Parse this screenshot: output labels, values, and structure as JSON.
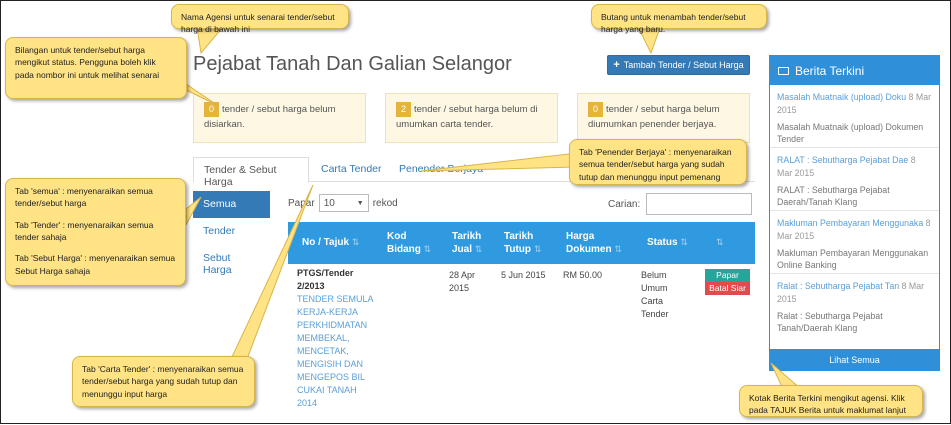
{
  "page": {
    "title": "Pejabat Tanah Dan Galian Selangor",
    "add_button": "Tambah Tender / Sebut Harga"
  },
  "stats": [
    {
      "count": "0",
      "text_a": "tender / sebut harga belum",
      "text_b": "disiarkan."
    },
    {
      "count": "2",
      "text_a": "tender / sebut harga belum di",
      "text_b": "umumkan carta tender."
    },
    {
      "count": "0",
      "text_a": "tender / sebut harga belum",
      "text_b": "diumumkan penender berjaya."
    }
  ],
  "tabs": [
    "Tender & Sebut Harga",
    "Carta Tender",
    "Penender Berjaya"
  ],
  "sidebar": [
    "Semua",
    "Tender",
    "Sebut Harga"
  ],
  "table_controls": {
    "page_label": "Papar",
    "page_value": "10",
    "rekod_label": "rekod",
    "search_label": "Carian:"
  },
  "table": {
    "headers": [
      {
        "a": "No / Tajuk",
        "b": ""
      },
      {
        "a": "Kod",
        "b": "Bidang"
      },
      {
        "a": "Tarikh",
        "b": "Jual"
      },
      {
        "a": "Tarikh",
        "b": "Tutup"
      },
      {
        "a": "Harga",
        "b": "Dokumen"
      },
      {
        "a": "Status",
        "b": ""
      }
    ],
    "sort_icon": "⇅",
    "row": {
      "no_a": "PTGS/Tender",
      "no_b": "2/2013",
      "tajuk": [
        "TENDER SEMULA",
        "KERJA-KERJA",
        "PERKHIDMATAN",
        "MEMBEKAL,",
        "MENCETAK,",
        "MENGISIH DAN",
        "MENGEPOS BIL",
        "CUKAI TANAH",
        "2014"
      ],
      "jual_a": "28 Apr",
      "jual_b": "2015",
      "tutup": "5 Jun 2015",
      "harga": "RM 50.00",
      "status": [
        "Belum",
        "Umum",
        "Carta",
        "Tender"
      ],
      "btn_papar": "Papar",
      "btn_batal": "Batal Siar"
    }
  },
  "news": {
    "header": "Berita Terkini",
    "footer": "Lihat Semua",
    "items": [
      {
        "title": "Masalah Muatnaik (upload) Doku",
        "date": "8 Mar 2015",
        "summary": "Masalah Muatnaik (upload) Dokumen Tender"
      },
      {
        "title": "RALAT : Sebutharga Pejabat Dae",
        "date": "8 Mar 2015",
        "summary": "RALAT : Sebutharga Pejabat Daerah/Tanah Klang"
      },
      {
        "title": "Makluman Pembayaran Menggunaka",
        "date": "8 Mar 2015",
        "summary": "Makluman Pembayaran Menggunakan Online Banking"
      },
      {
        "title": "Ralat : Sebutharga Pejabat Tan",
        "date": "8 Mar 2015",
        "summary": "Ralat : Sebutharga Pejabat Tanah/Daerah Klang"
      }
    ]
  },
  "callouts": {
    "agency": "Nama Agensi untuk senarai tender/sebut harga di bawah ini",
    "add": "Butang untuk menambah tender/sebut harga yang baru.",
    "count": "Bilangan untuk tender/sebut harga mengikut status. Pengguna boleh klik pada nombor ini untuk melihat senarai",
    "penender": "Tab 'Penender Berjaya' : menyenaraikan semua tender/sebut harga yang sudah tutup dan menunggu input pemenang",
    "side_a": "Tab 'semua' : menyenaraikan semua tender/sebut harga",
    "side_b": "Tab 'Tender' : menyenaraikan semua tender sahaja",
    "side_c": "Tab 'Sebut Harga' : menyenaraikan semua Sebut Harga sahaja",
    "carta": "Tab 'Carta Tender' : menyenaraikan semua tender/sebut harga yang sudah tutup dan menunggu input harga",
    "berita": "Kotak Berita Terkini mengikut agensi. Klik pada TAJUK Berita untuk maklumat lanjut"
  }
}
